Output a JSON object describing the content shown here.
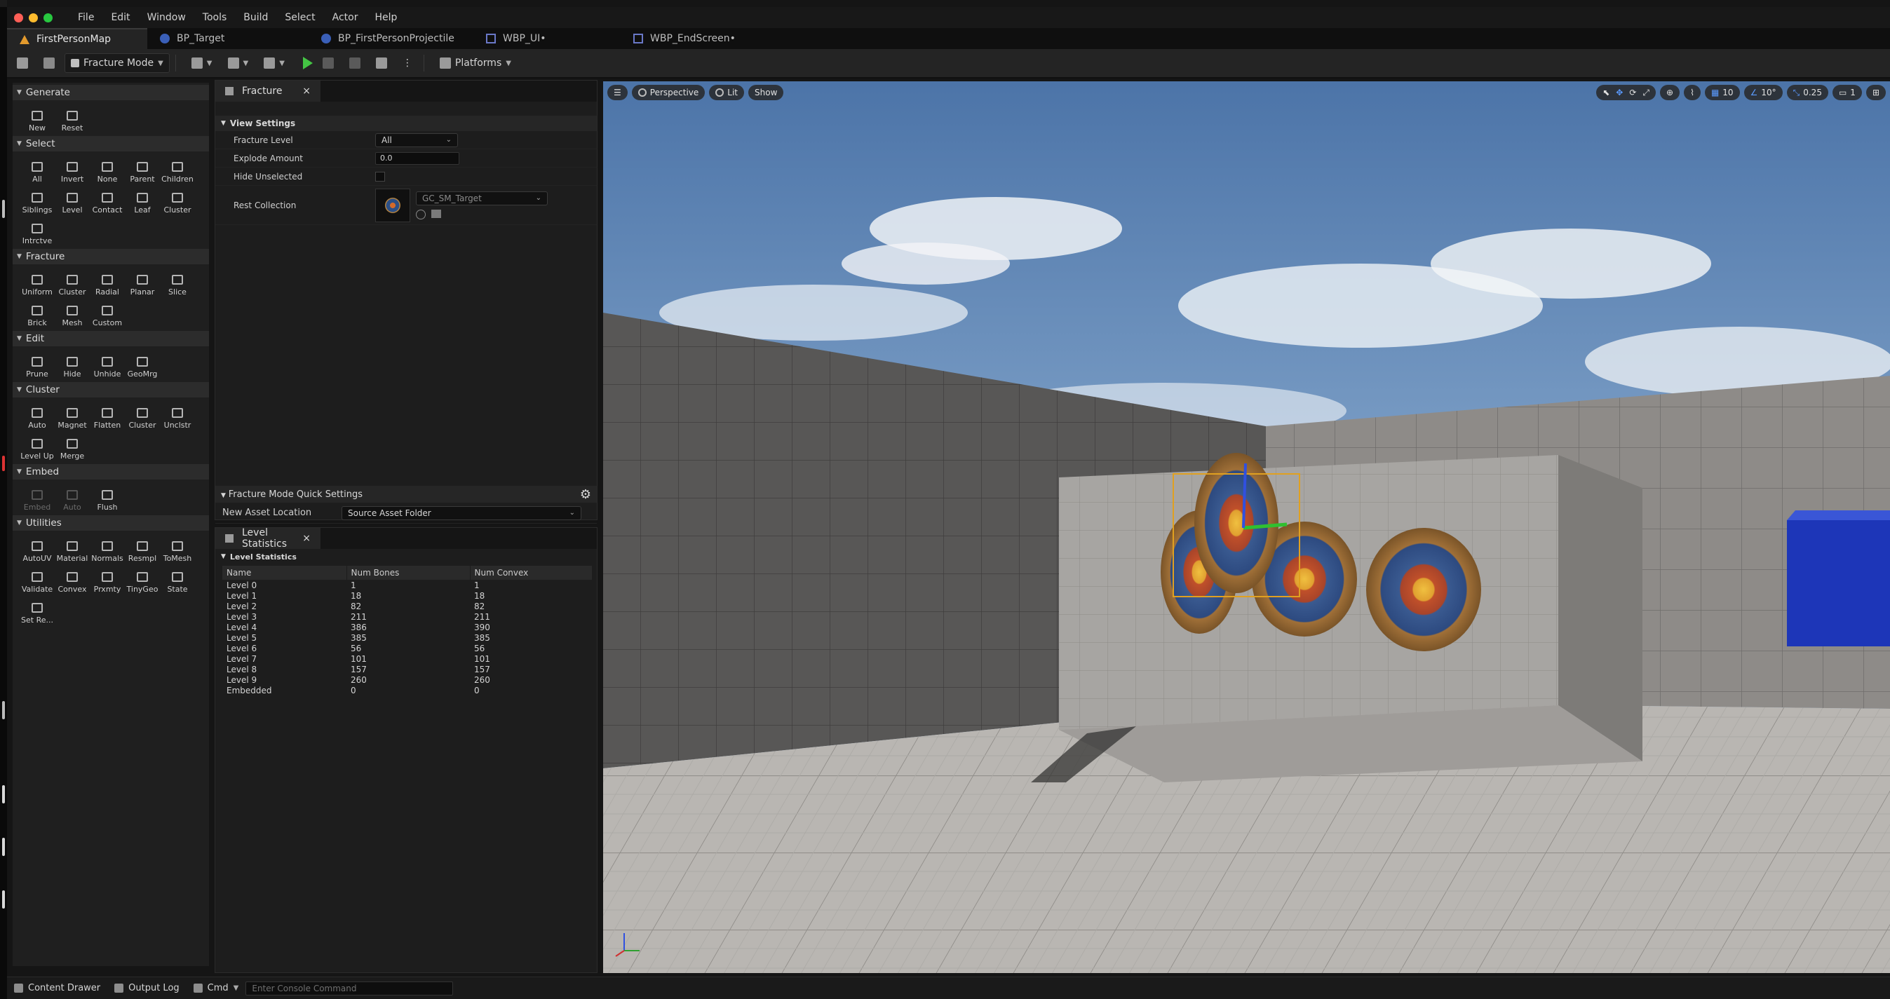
{
  "menu": [
    "File",
    "Edit",
    "Window",
    "Tools",
    "Build",
    "Select",
    "Actor",
    "Help"
  ],
  "tabs": [
    {
      "label": "FirstPersonMap"
    },
    {
      "label": "BP_Target"
    },
    {
      "label": "BP_FirstPersonProjectile"
    },
    {
      "label": "WBP_UI•"
    },
    {
      "label": "WBP_EndScreen•"
    }
  ],
  "toolbar": {
    "mode": "Fracture Mode",
    "platforms": "Platforms"
  },
  "palette": {
    "sections": [
      {
        "title": "Generate",
        "items": [
          "New",
          "Reset"
        ]
      },
      {
        "title": "Select",
        "items": [
          "All",
          "Invert",
          "None",
          "Parent",
          "Children",
          "Siblings",
          "Level",
          "Contact",
          "Leaf",
          "Cluster",
          "Intrctve"
        ]
      },
      {
        "title": "Fracture",
        "items": [
          "Uniform",
          "Cluster",
          "Radial",
          "Planar",
          "Slice",
          "Brick",
          "Mesh",
          "Custom"
        ]
      },
      {
        "title": "Edit",
        "items": [
          "Prune",
          "Hide",
          "Unhide",
          "GeoMrg"
        ]
      },
      {
        "title": "Cluster",
        "items": [
          "Auto",
          "Magnet",
          "Flatten",
          "Cluster",
          "Unclstr",
          "Level Up",
          "Merge"
        ]
      },
      {
        "title": "Embed",
        "items": [
          "Embed",
          "Auto",
          "Flush"
        ]
      },
      {
        "title": "Utilities",
        "items": [
          "AutoUV",
          "Material",
          "Normals",
          "Resmpl",
          "ToMesh",
          "Validate",
          "Convex",
          "Prxmty",
          "TinyGeo",
          "State",
          "Set Re..."
        ]
      }
    ]
  },
  "fracture_panel": {
    "tab": "Fracture",
    "view_settings": "View Settings",
    "fracture_level_label": "Fracture Level",
    "fracture_level_value": "All",
    "explode_label": "Explode Amount",
    "explode_value": "0.0",
    "hide_label": "Hide Unselected",
    "rest_label": "Rest Collection",
    "rest_value": "GC_SM_Target",
    "quick_settings": "Fracture Mode Quick Settings",
    "asset_loc_label": "New Asset Location",
    "asset_loc_value": "Source Asset Folder"
  },
  "level_stats": {
    "tab": "Level Statistics",
    "section": "Level Statistics",
    "headers": [
      "Name",
      "Num Bones",
      "Num Convex"
    ],
    "rows": [
      [
        "Level 0",
        "1",
        "1"
      ],
      [
        "Level 1",
        "18",
        "18"
      ],
      [
        "Level 2",
        "82",
        "82"
      ],
      [
        "Level 3",
        "211",
        "211"
      ],
      [
        "Level 4",
        "386",
        "390"
      ],
      [
        "Level 5",
        "385",
        "385"
      ],
      [
        "Level 6",
        "56",
        "56"
      ],
      [
        "Level 7",
        "101",
        "101"
      ],
      [
        "Level 8",
        "157",
        "157"
      ],
      [
        "Level 9",
        "260",
        "260"
      ],
      [
        "Embedded",
        "0",
        "0"
      ]
    ]
  },
  "viewport": {
    "perspective": "Perspective",
    "lit": "Lit",
    "show": "Show",
    "grid": "10",
    "angle": "10°",
    "scale": "0.25",
    "cam": "1"
  },
  "bottom": {
    "content_drawer": "Content Drawer",
    "output_log": "Output Log",
    "cmd": "Cmd",
    "console_placeholder": "Enter Console Command"
  }
}
